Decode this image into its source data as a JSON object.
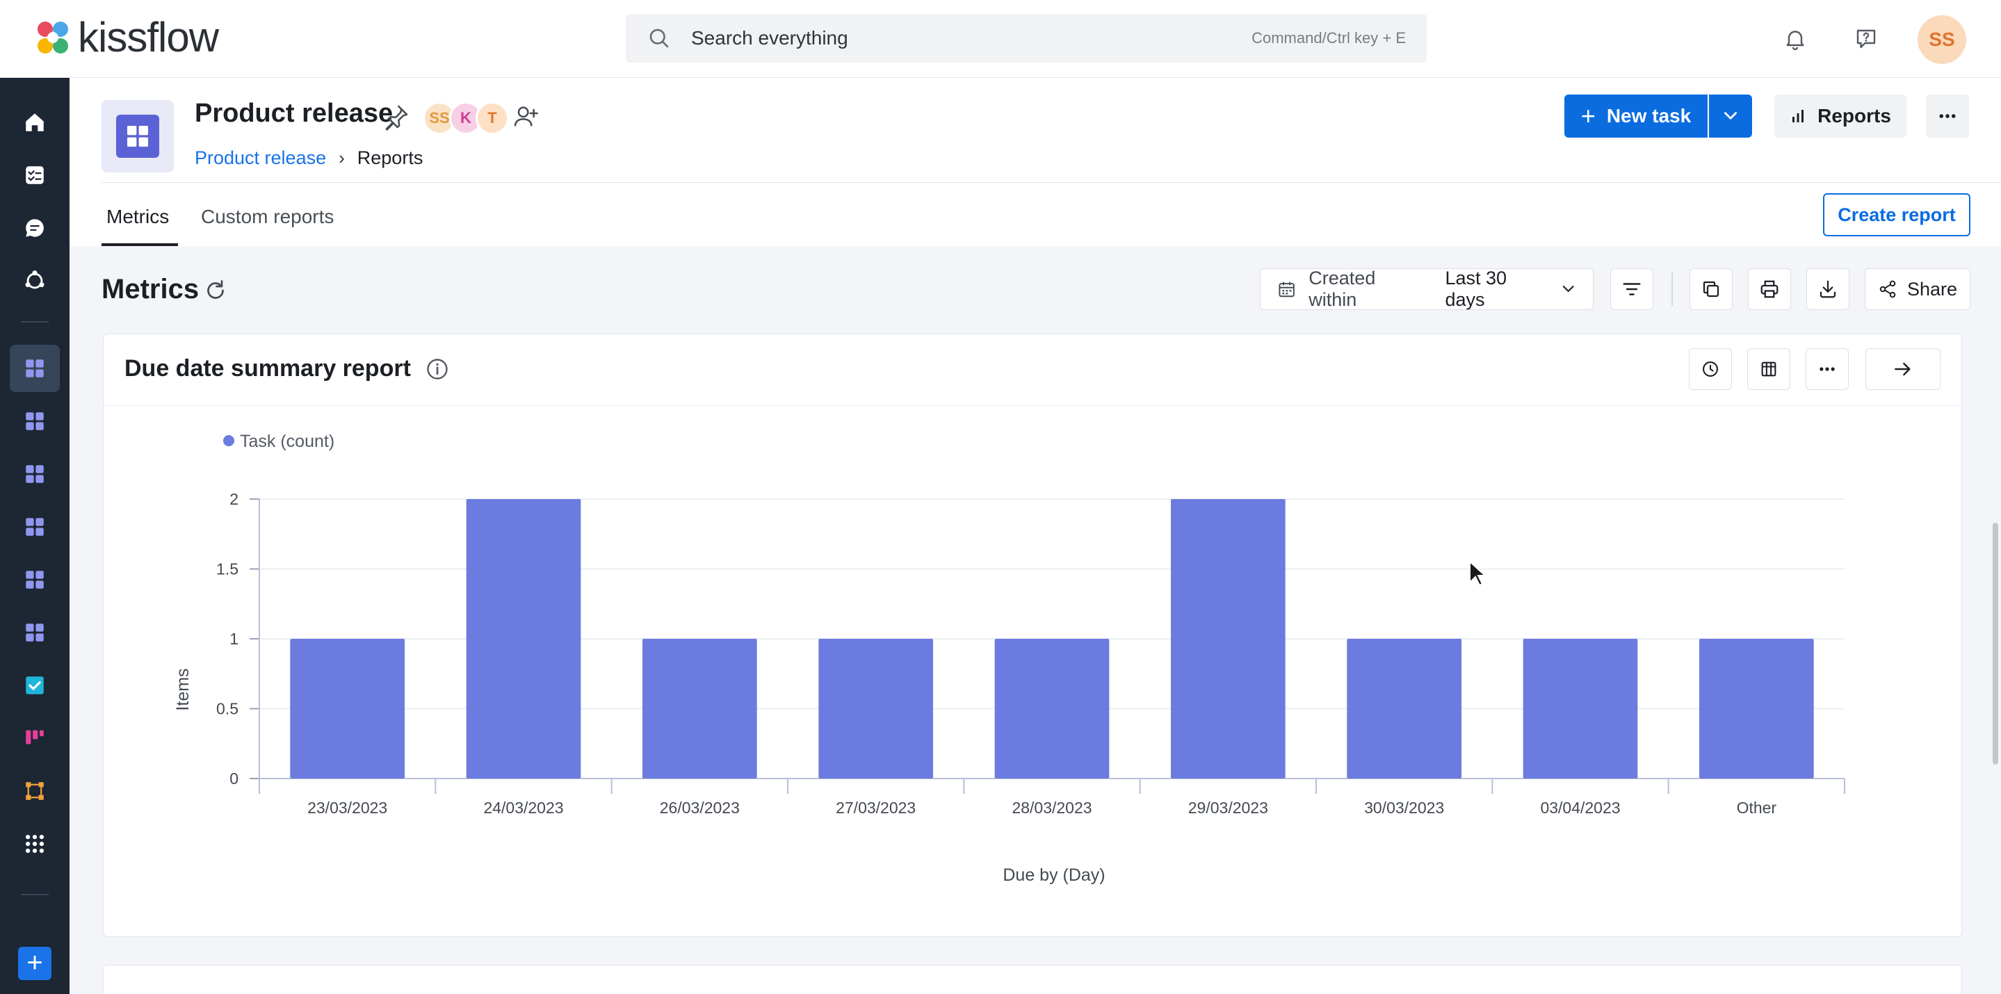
{
  "header": {
    "logo_text": "kissflow",
    "search_placeholder": "Search everything",
    "search_hint": "Command/Ctrl key + E",
    "user_initials": "SS"
  },
  "page": {
    "title": "Product release",
    "members": [
      "SS",
      "K",
      "T"
    ],
    "breadcrumb": [
      "Product release",
      "Reports"
    ],
    "new_task_label": "New task",
    "reports_label": "Reports",
    "tabs": [
      "Metrics",
      "Custom reports"
    ],
    "create_report_label": "Create report"
  },
  "metrics": {
    "title": "Metrics",
    "filter_label": "Created within",
    "filter_value": "Last 30 days",
    "share_label": "Share"
  },
  "card": {
    "title": "Due date summary report"
  },
  "colors": {
    "bar": "#6b7be0",
    "primary": "#0b6ce0",
    "rail": "#1d2633"
  },
  "chart_data": {
    "type": "bar",
    "legend": "Task (count)",
    "legend_position": "top-left",
    "categories": [
      "23/03/2023",
      "24/03/2023",
      "26/03/2023",
      "27/03/2023",
      "28/03/2023",
      "29/03/2023",
      "30/03/2023",
      "03/04/2023",
      "Other"
    ],
    "series": [
      {
        "name": "Task (count)",
        "values": [
          1,
          2,
          1,
          1,
          1,
          2,
          1,
          1,
          1
        ]
      }
    ],
    "xlabel": "Due by (Day)",
    "ylabel": "Items",
    "yticks": [
      "0",
      "0.5",
      "1",
      "1.5",
      "2"
    ],
    "ylim": [
      0,
      2
    ],
    "grid": true
  }
}
